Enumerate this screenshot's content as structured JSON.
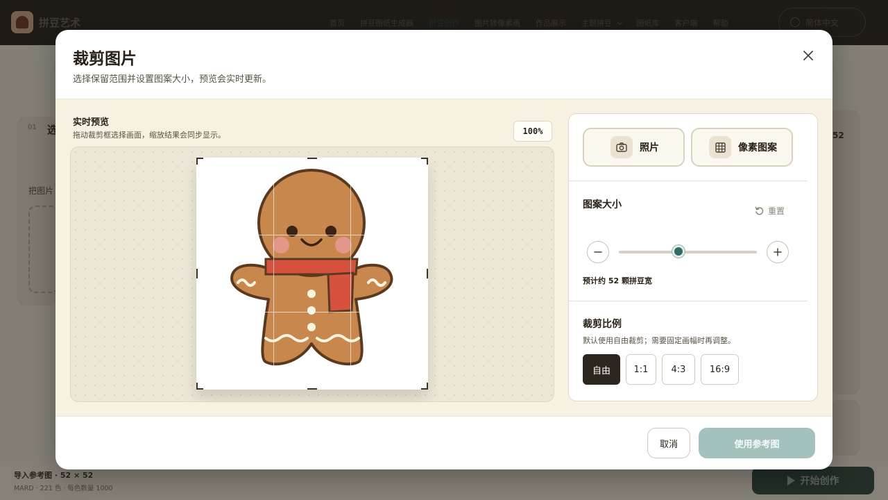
{
  "app": {
    "brand": "拼豆艺术",
    "nav": [
      {
        "label": "首页"
      },
      {
        "label": "拼豆图纸生成器"
      },
      {
        "label": "拼豆创作"
      },
      {
        "label": "图片转像素画"
      },
      {
        "label": "作品展示"
      },
      {
        "label": "主题拼豆"
      },
      {
        "label": "图纸库"
      },
      {
        "label": "客户端"
      },
      {
        "label": "帮助"
      }
    ],
    "language": "简体中文"
  },
  "background": {
    "step_number": "01",
    "step_title": "选",
    "upload_label": "把图片",
    "right_count": "52",
    "bottom_title": "导入参考图 · 52 × 52",
    "bottom_subtitle": "MARD · 221 色 · 每色数量 1000",
    "start_label": "开始创作"
  },
  "modal": {
    "title": "裁剪图片",
    "subtitle": "选择保留范围并设置图案大小，预览会实时更新。",
    "preview": {
      "title": "实时预览",
      "subtitle": "拖动裁剪框选择画面，缩放结果会同步显示。",
      "zoom": "100%"
    },
    "modes": {
      "photo_label": "照片",
      "pixel_label": "像素图案"
    },
    "size": {
      "title": "图案大小",
      "reset_label": "重置",
      "slider_fraction": 0.43,
      "estimate": "预计约 52 颗拼豆宽"
    },
    "aspect": {
      "title": "裁剪比例",
      "subtitle": "默认使用自由裁剪；需要固定画幅时再调整。",
      "options": [
        {
          "label": "自由",
          "active": true
        },
        {
          "label": "1:1",
          "active": false
        },
        {
          "label": "4:3",
          "active": false
        },
        {
          "label": "16:9",
          "active": false
        }
      ]
    },
    "footer": {
      "cancel_label": "取消",
      "confirm_label": "使用参考图"
    }
  },
  "colors": {
    "accent": "#2f6e66",
    "confirm_disabled": "#a3c2bd",
    "active_option": "#2d261e",
    "gingerbread": "#c8874d",
    "scarf": "#d6523f"
  },
  "icons": [
    "close-icon",
    "camera-icon",
    "grid-icon",
    "reset-icon",
    "minus-icon",
    "plus-icon",
    "globe-icon",
    "chevron-down-icon",
    "play-icon"
  ]
}
